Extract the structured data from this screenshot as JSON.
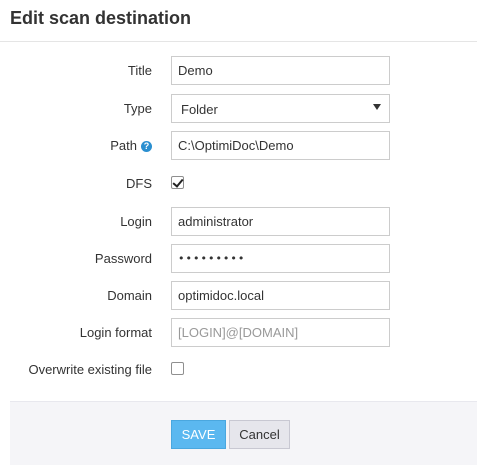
{
  "dialog": {
    "title": "Edit scan destination"
  },
  "form": {
    "title": {
      "label": "Title",
      "value": "Demo"
    },
    "type": {
      "label": "Type",
      "value": "Folder"
    },
    "path": {
      "label": "Path",
      "help_icon": "question-circle-icon",
      "value": "C:\\OptimiDoc\\Demo"
    },
    "dfs": {
      "label": "DFS",
      "checked": true
    },
    "login": {
      "label": "Login",
      "value": "administrator"
    },
    "password": {
      "label": "Password",
      "value": "•••••••••"
    },
    "domain": {
      "label": "Domain",
      "value": "optimidoc.local"
    },
    "login_format": {
      "label": "Login format",
      "placeholder": "[LOGIN]@[DOMAIN]"
    },
    "overwrite": {
      "label": "Overwrite existing file",
      "checked": false
    }
  },
  "buttons": {
    "save": "SAVE",
    "cancel": "Cancel"
  },
  "colors": {
    "accent": "#5bb8f0",
    "help_icon": "#2a8fd0",
    "footer_bg": "#f5f5f8"
  }
}
